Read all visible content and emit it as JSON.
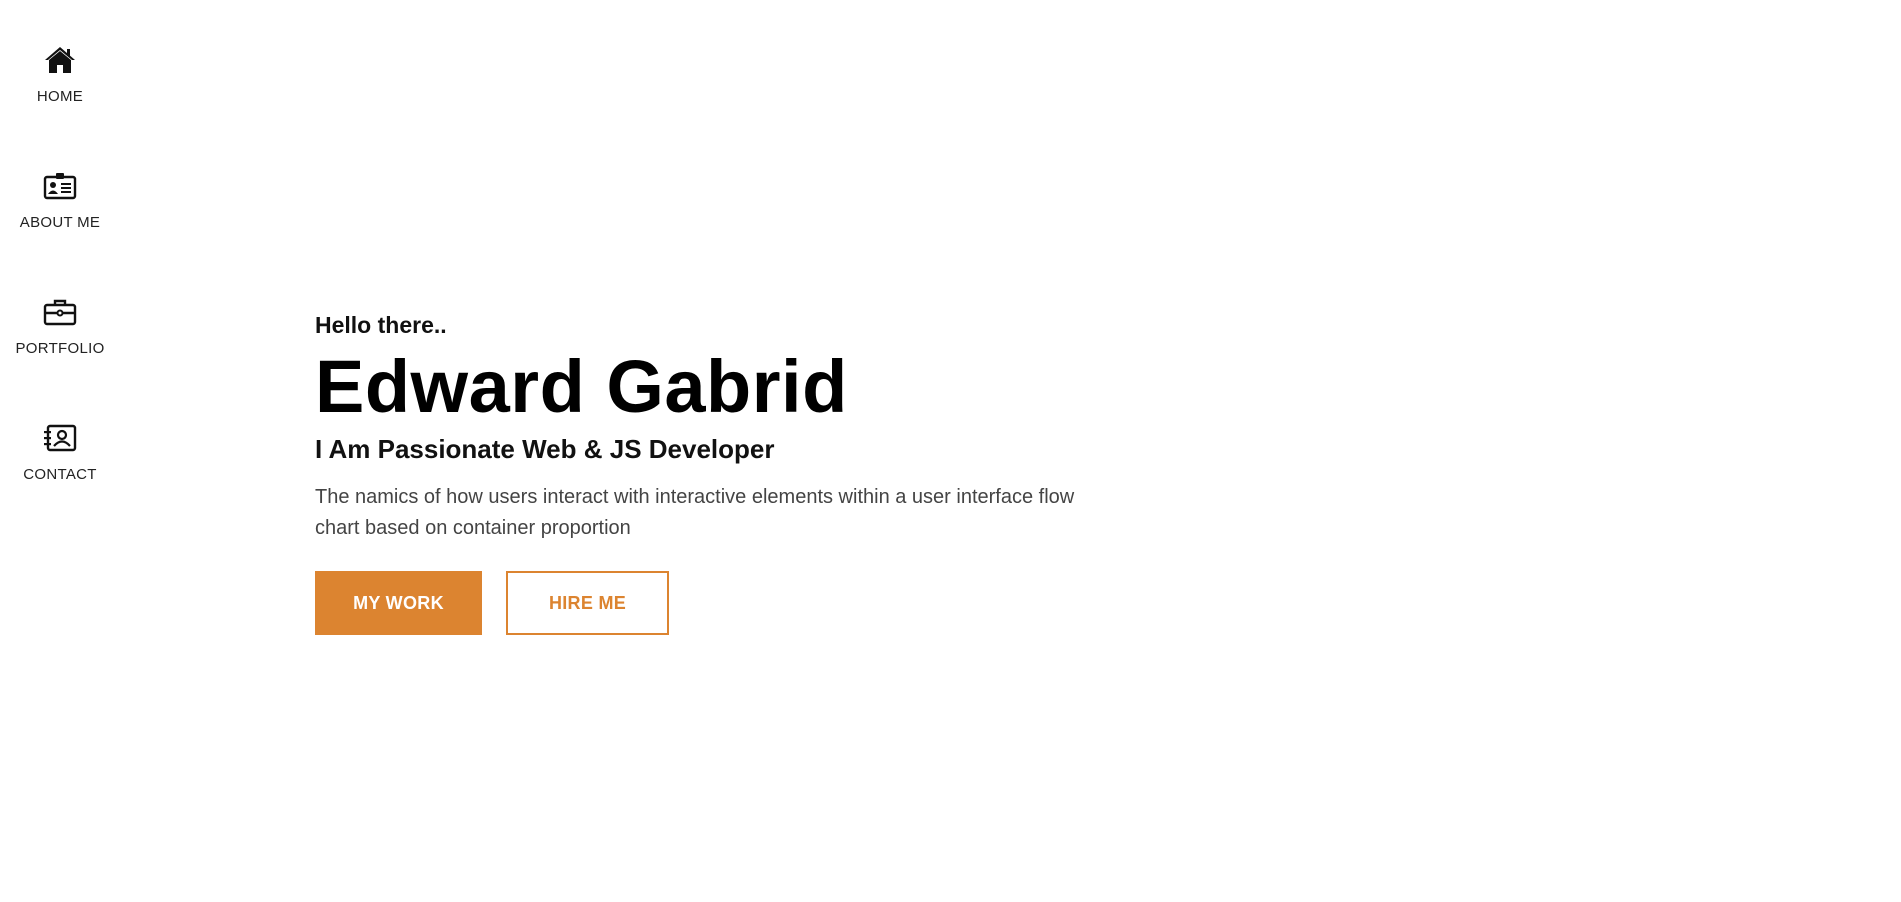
{
  "sidebar": {
    "items": [
      {
        "label": "HOME",
        "icon": "home-icon"
      },
      {
        "label": "ABOUT ME",
        "icon": "id-card-icon"
      },
      {
        "label": "PORTFOLIO",
        "icon": "briefcase-icon"
      },
      {
        "label": "CONTACT",
        "icon": "contact-book-icon"
      }
    ]
  },
  "hero": {
    "greeting": "Hello there..",
    "name": "Edward Gabrid",
    "role": "I Am Passionate Web & JS Developer",
    "description": "The namics of how users interact with interactive elements within a user interface flow chart based on container proportion",
    "primary_button": "MY WORK",
    "secondary_button": "HIRE ME"
  },
  "colors": {
    "accent": "#dc8430",
    "text": "#000000",
    "muted_text": "#444444"
  }
}
